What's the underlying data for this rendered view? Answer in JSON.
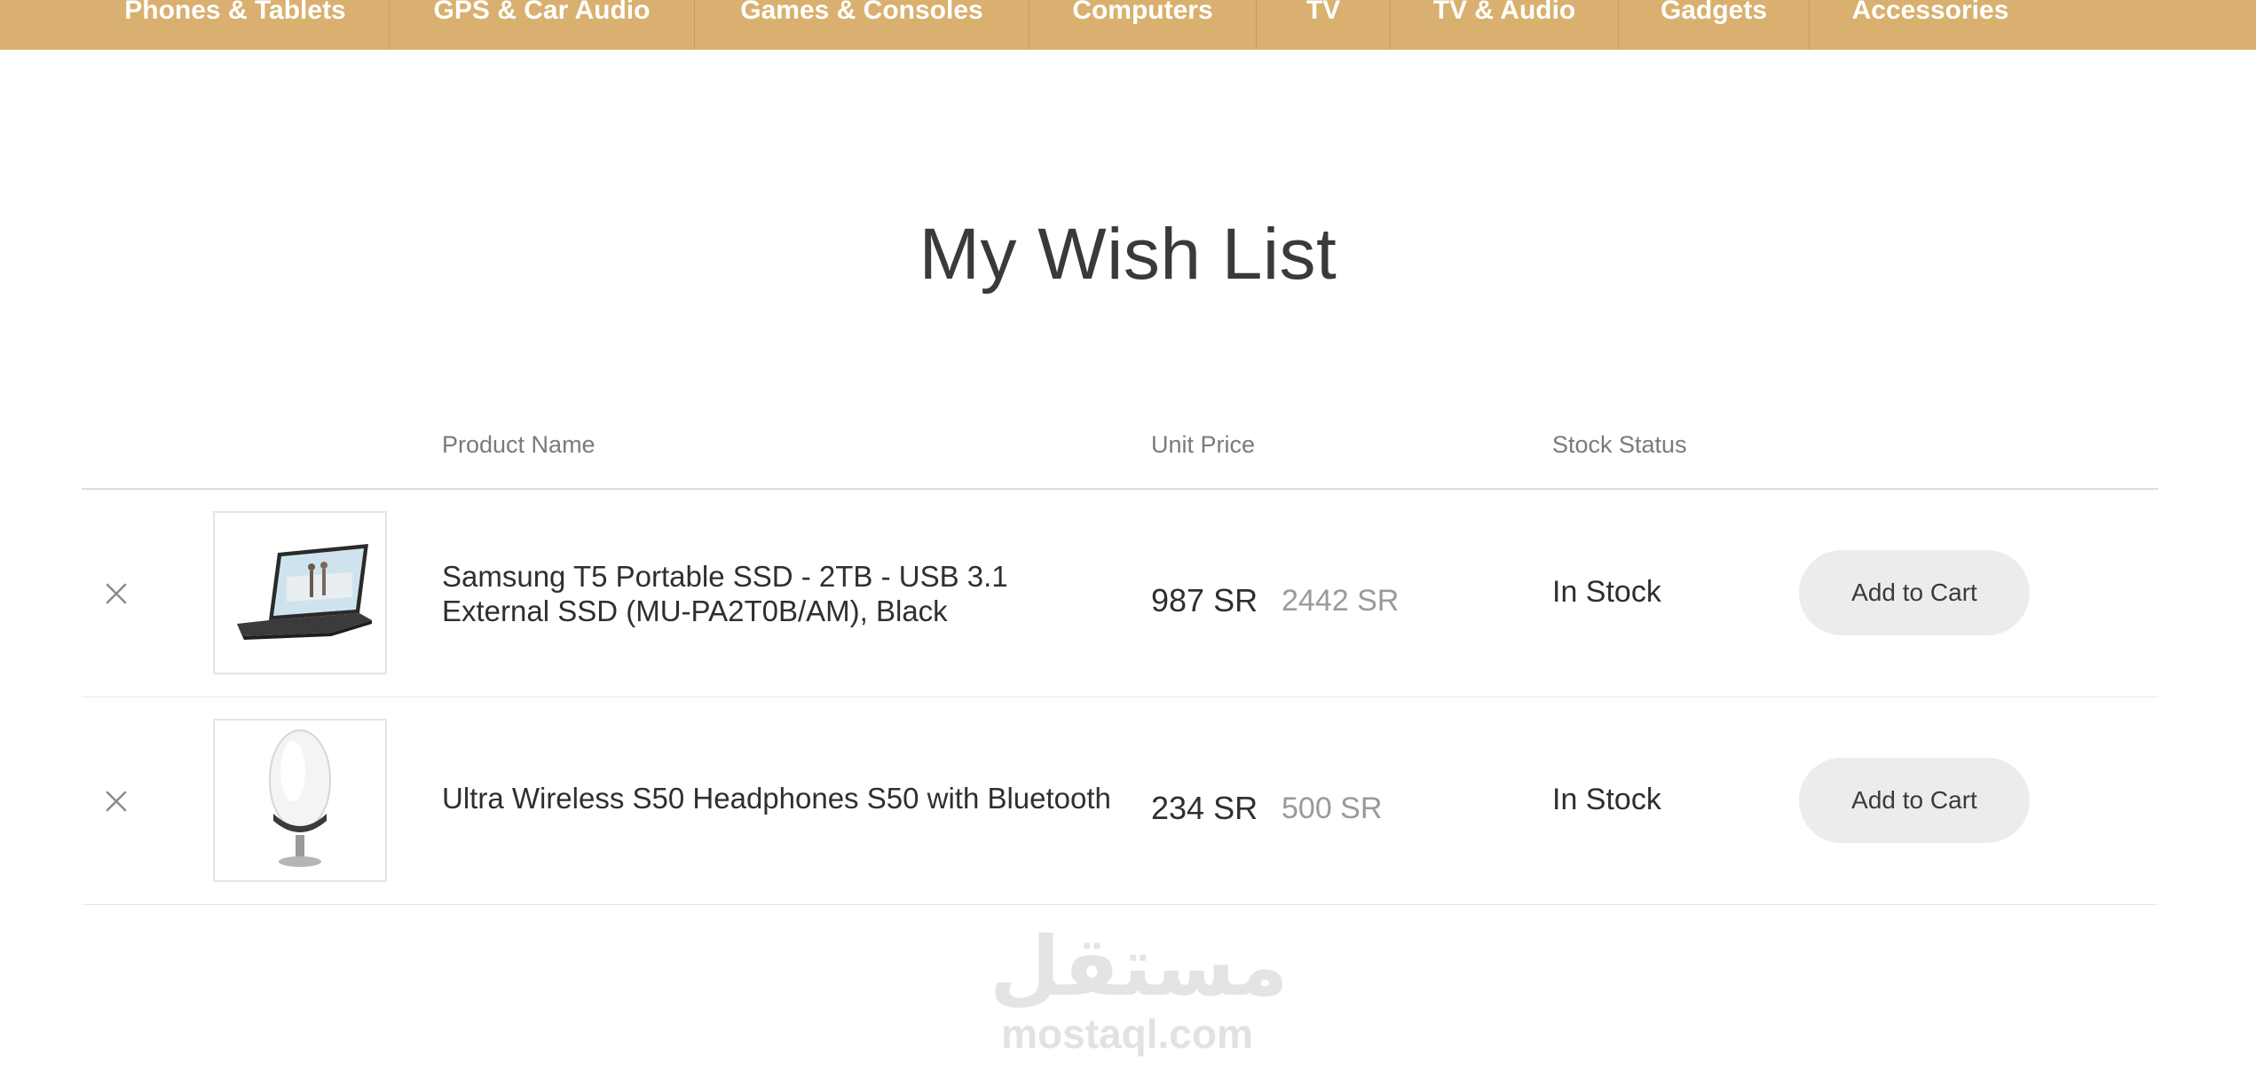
{
  "nav": {
    "items": [
      {
        "label": "Phones & Tablets"
      },
      {
        "label": "GPS & Car Audio"
      },
      {
        "label": "Games & Consoles"
      },
      {
        "label": "Computers"
      },
      {
        "label": "TV"
      },
      {
        "label": "TV & Audio"
      },
      {
        "label": "Gadgets"
      },
      {
        "label": "Accessories"
      }
    ]
  },
  "page": {
    "title": "My Wish List"
  },
  "table": {
    "headers": {
      "product_name": "Product Name",
      "unit_price": "Unit Price",
      "stock_status": "Stock Status"
    },
    "rows": [
      {
        "name": "Samsung T5 Portable SSD - 2TB - USB 3.1 External SSD (MU-PA2T0B/AM), Black",
        "price": "987 SR",
        "old_price": "2442 SR",
        "stock": "In Stock",
        "action": "Add to Cart",
        "image_icon": "laptop-icon"
      },
      {
        "name": "Ultra Wireless S50 Headphones S50 with Bluetooth",
        "price": "234 SR",
        "old_price": "500 SR",
        "stock": "In Stock",
        "action": "Add to Cart",
        "image_icon": "speaker-icon"
      }
    ]
  },
  "watermark": {
    "arabic": "مستقل",
    "latin": "mostaql.com"
  },
  "colors": {
    "nav_bg": "#d9b06f",
    "button_bg": "#ececea"
  }
}
